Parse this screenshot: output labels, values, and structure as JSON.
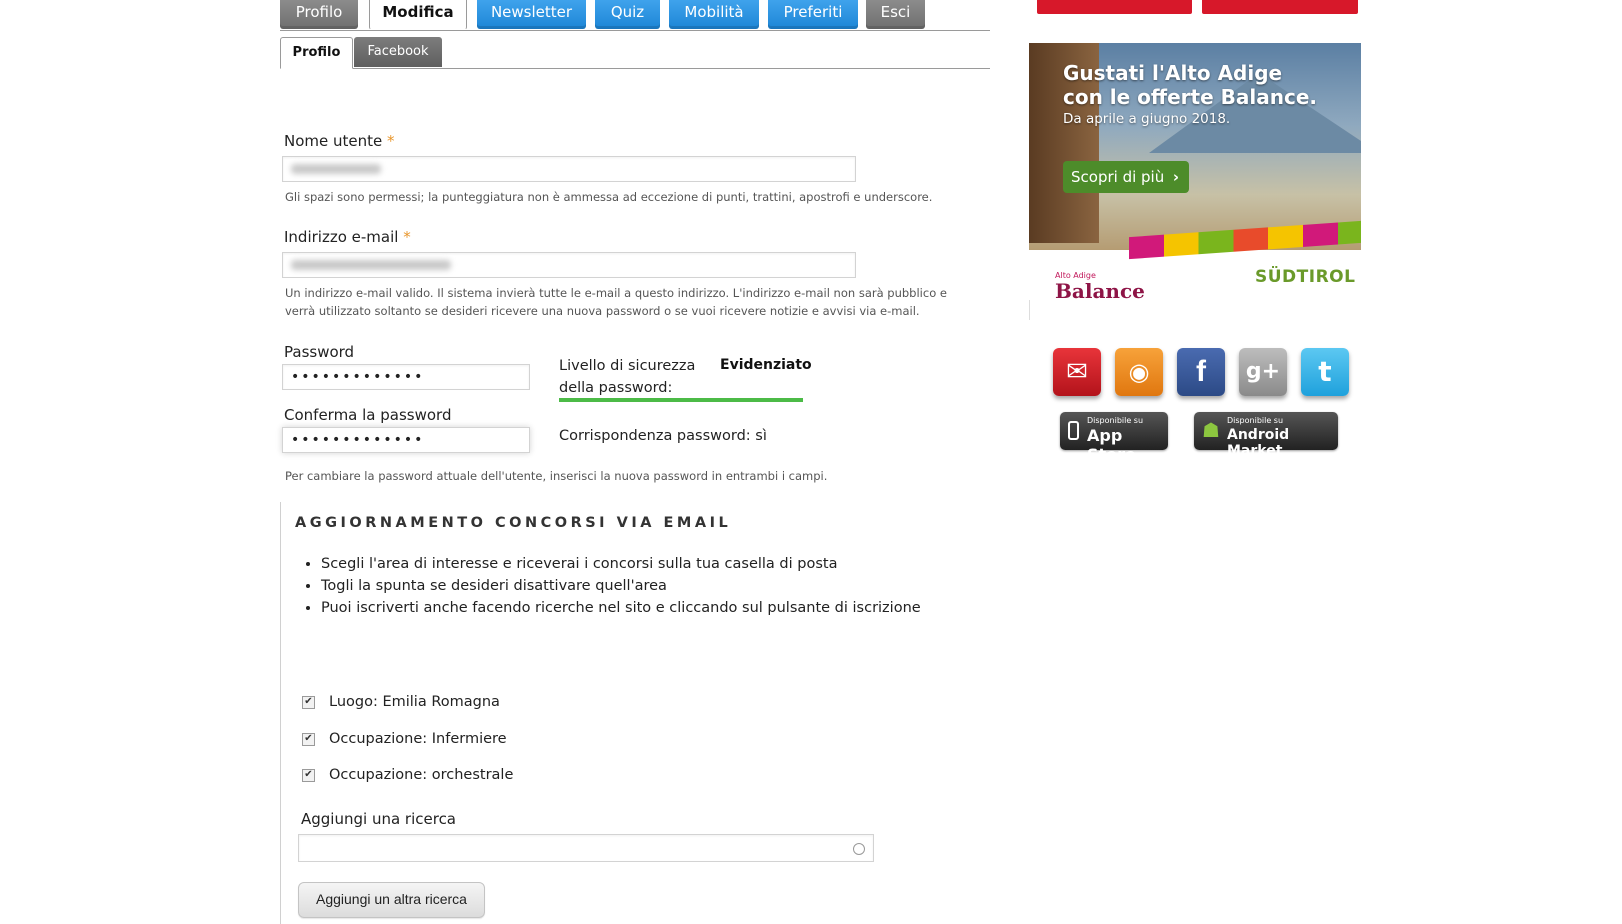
{
  "tabs": [
    {
      "label": "Profilo",
      "style": "grey"
    },
    {
      "label": "Modifica",
      "style": "active"
    },
    {
      "label": "Newsletter",
      "style": "blue"
    },
    {
      "label": "Quiz",
      "style": "blue"
    },
    {
      "label": "Mobilità",
      "style": "blue"
    },
    {
      "label": "Preferiti",
      "style": "blue"
    },
    {
      "label": "Esci",
      "style": "grey"
    }
  ],
  "subtabs": [
    {
      "label": "Profilo"
    },
    {
      "label": "Facebook"
    }
  ],
  "form": {
    "required_mark": "*",
    "username": {
      "label": "Nome utente",
      "description": "Gli spazi sono permessi; la punteggiatura non è ammessa ad eccezione di punti, trattini, apostrofi e underscore."
    },
    "email": {
      "label": "Indirizzo e-mail",
      "description_1": "Un indirizzo e-mail valido. Il sistema invierà tutte le e-mail a questo indirizzo. L'indirizzo e-mail non sarà pubblico e",
      "description_2": "verrà utilizzato soltanto se desideri ricevere una nuova password o se vuoi ricevere notizie e avvisi via e-mail."
    },
    "password": {
      "label": "Password",
      "value": "•••••••••••••"
    },
    "confirm_password": {
      "label": "Conferma la password",
      "value": "•••••••••••••"
    },
    "strength": {
      "label_1": "Livello di sicurezza",
      "label_2": "della password:",
      "value": "Evidenziato",
      "level": 1.0,
      "color": "#4cbb47"
    },
    "match": "Corrispondenza password: sì",
    "password_description": "Per cambiare la password attuale dell'utente, inserisci la nuova password in entrambi i campi."
  },
  "alerts": {
    "legend": "AGGIORNAMENTO CONCORSI VIA EMAIL",
    "bullets": [
      "Scegli l'area di interesse e riceverai i concorsi sulla tua casella di posta",
      "Togli la spunta se desideri disattivare quell'area",
      "Puoi iscriverti anche facendo ricerche nel sito e cliccando sul pulsante di iscrizione"
    ],
    "checkboxes": [
      {
        "label": "Luogo: Emilia Romagna",
        "checked": true
      },
      {
        "label": "Occupazione: Infermiere",
        "checked": true
      },
      {
        "label": "Occupazione: orchestrale",
        "checked": true
      }
    ],
    "add_search_label": "Aggiungi una ricerca",
    "add_button": "Aggiungi un altra ricerca"
  },
  "ad": {
    "title_1": "Gustati l'Alto Adige",
    "title_2": "con le offerte Balance.",
    "subtitle": "Da aprile a giugno 2018.",
    "cta": "Scopri di più",
    "cta_arrow": "›",
    "logo_small": "Alto Adige",
    "logo": "Balance",
    "brand": "SÜDTIROL"
  },
  "social": [
    {
      "name": "mail-icon",
      "glyph": "✉",
      "color": "#d61f26"
    },
    {
      "name": "rss-icon",
      "glyph": "◉",
      "color": "#f28a1a"
    },
    {
      "name": "facebook-icon",
      "glyph": "f",
      "color": "#3b5a98"
    },
    {
      "name": "google-plus-icon",
      "glyph": "g+",
      "color": "#9a9a9a"
    },
    {
      "name": "twitter-icon",
      "glyph": "t",
      "color": "#2fb2ec"
    }
  ],
  "stores": [
    {
      "small": "Disponibile su",
      "big": "App Store",
      "icon": ""
    },
    {
      "small": "Disponibile su",
      "big": "Android Market",
      "icon": "☗"
    }
  ],
  "colors": {
    "blue_tab": "#1d86d6",
    "grey_tab": "#6f6f6f",
    "required": "#e8962c",
    "red_button": "#d7182a"
  }
}
